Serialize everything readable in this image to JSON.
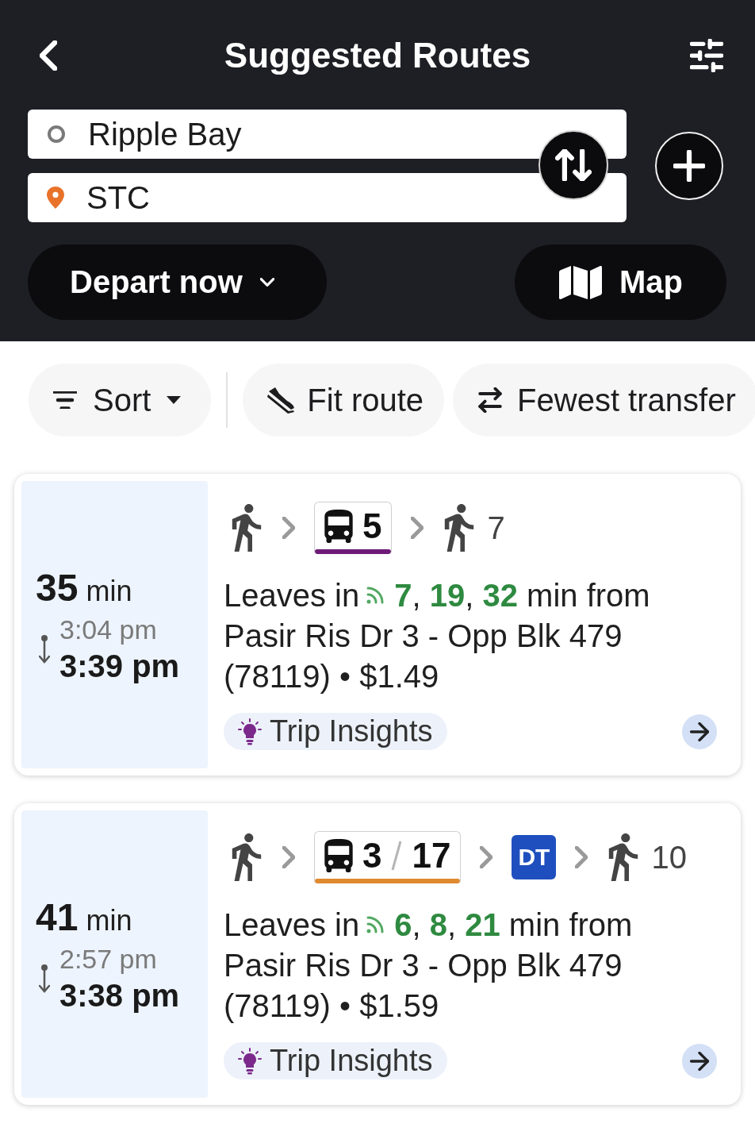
{
  "header": {
    "title": "Suggested Routes"
  },
  "locations": [
    {
      "kind": "origin",
      "value": "Ripple Bay"
    },
    {
      "kind": "destination",
      "value": "STC"
    }
  ],
  "depart": {
    "label": "Depart now"
  },
  "map": {
    "label": "Map"
  },
  "filters": [
    {
      "kind": "sort",
      "label": "Sort"
    },
    {
      "kind": "fit",
      "label": "Fit route"
    },
    {
      "kind": "transfers",
      "label": "Fewest transfer"
    }
  ],
  "routes": [
    {
      "duration": "35",
      "duration_unit": "min",
      "depart_time": "3:04 pm",
      "arrive_time": "3:39 pm",
      "legs": [
        {
          "kind": "walk"
        },
        {
          "kind": "bus",
          "services": [
            "5"
          ],
          "color": "#6e1b78"
        },
        {
          "kind": "walk",
          "label": "7"
        }
      ],
      "leaves_label": "Leaves in",
      "departure": "**7**, **19**, **32** min from Pasir Ris Dr 3 - Opp Blk 479 (78119) • $1.49",
      "insights": "Trip Insights"
    },
    {
      "duration": "41",
      "duration_unit": "min",
      "depart_time": "2:57 pm",
      "arrive_time": "3:38 pm",
      "legs": [
        {
          "kind": "walk"
        },
        {
          "kind": "bus",
          "services": [
            "3",
            "17"
          ],
          "color": "#e08a30"
        },
        {
          "kind": "train",
          "label": "DT",
          "color": "#1f4fbf"
        },
        {
          "kind": "walk",
          "label": "10"
        }
      ],
      "leaves_label": "Leaves in",
      "departure": "**6**, **8**, **21** min from Pasir Ris Dr 3 - Opp Blk 479 (78119) • $1.59",
      "insights": "Trip Insights"
    }
  ]
}
